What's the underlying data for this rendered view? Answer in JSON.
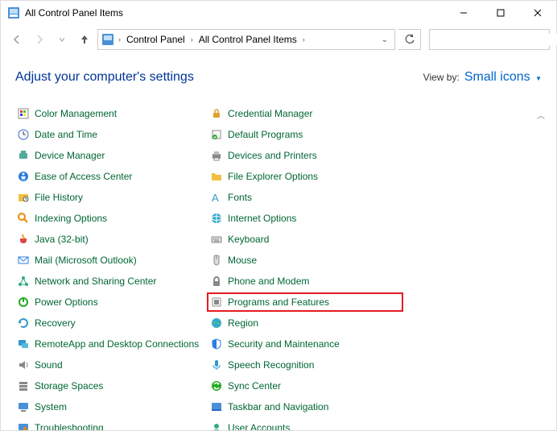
{
  "window": {
    "title": "All Control Panel Items"
  },
  "breadcrumb": {
    "items": [
      "Control Panel",
      "All Control Panel Items"
    ]
  },
  "search": {
    "placeholder": ""
  },
  "header": {
    "adjust_text": "Adjust your computer's settings",
    "view_by_label": "View by:",
    "view_by_value": "Small icons"
  },
  "items_col1": [
    {
      "label": "Color Management"
    },
    {
      "label": "Date and Time"
    },
    {
      "label": "Device Manager"
    },
    {
      "label": "Ease of Access Center"
    },
    {
      "label": "File History"
    },
    {
      "label": "Indexing Options"
    },
    {
      "label": "Java (32-bit)"
    },
    {
      "label": "Mail (Microsoft Outlook)"
    },
    {
      "label": "Network and Sharing Center"
    },
    {
      "label": "Power Options"
    },
    {
      "label": "Recovery"
    },
    {
      "label": "RemoteApp and Desktop Connections"
    },
    {
      "label": "Sound"
    },
    {
      "label": "Storage Spaces"
    },
    {
      "label": "System"
    },
    {
      "label": "Troubleshooting"
    }
  ],
  "items_col2": [
    {
      "label": "Credential Manager"
    },
    {
      "label": "Default Programs"
    },
    {
      "label": "Devices and Printers"
    },
    {
      "label": "File Explorer Options"
    },
    {
      "label": "Fonts"
    },
    {
      "label": "Internet Options"
    },
    {
      "label": "Keyboard"
    },
    {
      "label": "Mouse"
    },
    {
      "label": "Phone and Modem"
    },
    {
      "label": "Programs and Features",
      "highlight": true
    },
    {
      "label": "Region"
    },
    {
      "label": "Security and Maintenance"
    },
    {
      "label": "Speech Recognition"
    },
    {
      "label": "Sync Center"
    },
    {
      "label": "Taskbar and Navigation"
    },
    {
      "label": "User Accounts"
    }
  ]
}
